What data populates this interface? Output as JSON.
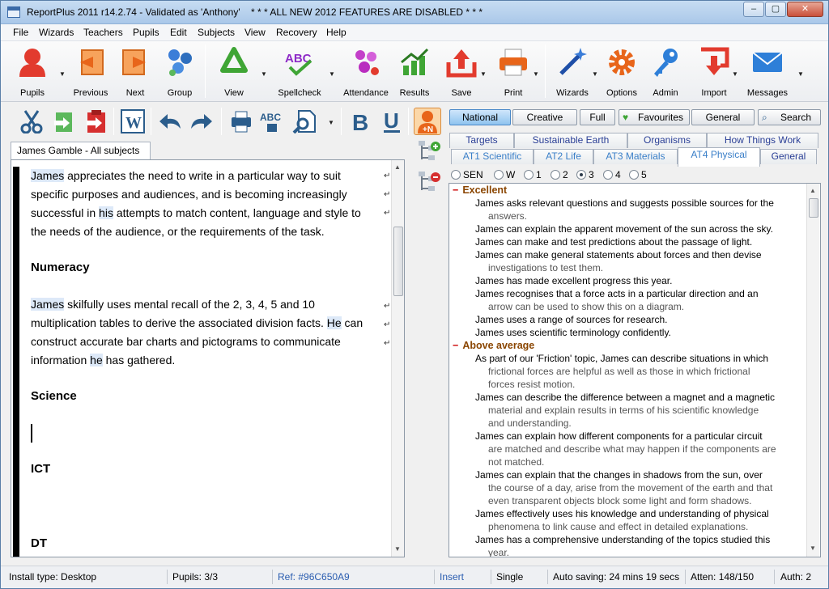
{
  "window": {
    "title": "ReportPlus 2011 r14.2.74 - Validated as 'Anthony'",
    "notice": "* * *  ALL NEW 2012 FEATURES ARE DISABLED  * * *",
    "min": "–",
    "max": "▢",
    "close": "✕"
  },
  "menu": [
    "File",
    "Wizards",
    "Teachers",
    "Pupils",
    "Edit",
    "Subjects",
    "View",
    "Recovery",
    "Help"
  ],
  "toolbar": {
    "pupils": "Pupils",
    "previous": "Previous",
    "next": "Next",
    "group": "Group",
    "view": "View",
    "spellcheck": "Spellcheck",
    "attendance": "Attendance",
    "results": "Results",
    "save": "Save",
    "print": "Print",
    "wizards": "Wizards",
    "options": "Options",
    "admin": "Admin",
    "import": "Import",
    "messages": "Messages"
  },
  "filters": {
    "national": "National",
    "creative": "Creative",
    "full": "Full",
    "favourites": "Favourites",
    "general": "General",
    "search": "Search"
  },
  "tabs_row1": [
    "Targets",
    "Sustainable Earth",
    "Organisms",
    "How Things Work"
  ],
  "tabs_row2": [
    "AT1 Scientific",
    "AT2 Life",
    "AT3 Materials",
    "AT4 Physical",
    "General"
  ],
  "left_tab": "James Gamble - All subjects",
  "levels": [
    "SEN",
    "W",
    "1",
    "2",
    "3",
    "4",
    "5"
  ],
  "selected_level": "3",
  "editor": {
    "p1": {
      "name": "James",
      "text": " appreciates the need to write in a particular way to suit specific purposes and audiences, and is becoming increasingly successful in ",
      "his": "his",
      "rest": " attempts to match content, language and style to the needs of the audience, or the requirements of the task."
    },
    "h_numeracy": "Numeracy",
    "p2": {
      "name": "James",
      "a": " skilfully uses mental recall of the 2, 3, 4, 5 and 10 multiplication tables to derive the associated division facts.  ",
      "he1": "He",
      "b": " can construct accurate bar charts and pictograms to communicate information ",
      "he2": "he",
      "c": " has gathered."
    },
    "h_science": "Science",
    "h_ict": "ICT",
    "h_dt": "DT"
  },
  "categories": [
    {
      "title": "Excellent",
      "items": [
        {
          "first": "James asks relevant questions and suggests possible sources for the",
          "cont": [
            "answers."
          ]
        },
        {
          "first": "James can explain the apparent movement of the sun across the sky.",
          "cont": []
        },
        {
          "first": "James can make and test predictions about the passage of light.",
          "cont": []
        },
        {
          "first": "James can make general statements about forces and then devise",
          "cont": [
            "investigations to test them."
          ]
        },
        {
          "first": "James has made excellent progress this year.",
          "cont": []
        },
        {
          "first": "James recognises that a force acts in a particular direction and an",
          "cont": [
            "arrow can be used to show this on a diagram."
          ]
        },
        {
          "first": "James uses a range of sources for research.",
          "cont": []
        },
        {
          "first": "James uses scientific terminology confidently.",
          "cont": []
        }
      ]
    },
    {
      "title": "Above average",
      "items": [
        {
          "first": "As part of our 'Friction' topic, James can describe situations in which",
          "cont": [
            "frictional forces are helpful as well as those in which frictional",
            "forces resist motion."
          ]
        },
        {
          "first": "James can describe the difference between a magnet and a magnetic",
          "cont": [
            "material and explain results in terms of his scientific knowledge",
            "and understanding."
          ]
        },
        {
          "first": "James can explain how different components for a particular circuit",
          "cont": [
            "are matched and describe what may happen if the components are",
            "not matched."
          ]
        },
        {
          "first": "James can explain that the changes in shadows from the sun, over",
          "cont": [
            "the course of a day, arise from the movement of the earth and that",
            "even transparent objects block some light and form shadows."
          ]
        },
        {
          "first": "James effectively uses his knowledge and understanding of physical",
          "cont": [
            "phenomena to link cause and effect in detailed explanations."
          ]
        },
        {
          "first": "James has a comprehensive understanding of the topics studied this",
          "cont": [
            "year."
          ]
        }
      ]
    }
  ],
  "status": {
    "install": "Install type: Desktop",
    "pupils": "Pupils: 3/3",
    "ref": "Ref: #96C650A9",
    "insert": "Insert",
    "single": "Single",
    "autosave": "Auto saving: 24 mins 19 secs",
    "atten": "Atten: 148/150",
    "auth": "Auth: 2"
  }
}
